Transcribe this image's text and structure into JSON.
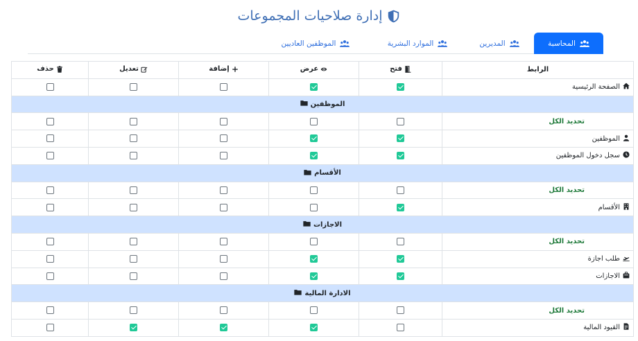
{
  "page": {
    "title": "إدارة صلاحيات المجموعات",
    "accent": "#0d6efd",
    "check_color": "#20c997",
    "group_row_color": "#cfe2ff"
  },
  "tabs": [
    {
      "label": "المحاسبة",
      "active": true,
      "icon": "users-icon"
    },
    {
      "label": "المديرين",
      "active": false,
      "icon": "users-icon"
    },
    {
      "label": "الموارد البشرية",
      "active": false,
      "icon": "users-icon"
    },
    {
      "label": "الموظفين العاديين",
      "active": false,
      "icon": "users-icon"
    }
  ],
  "columns": {
    "link": "الرابط",
    "open": "فتح",
    "view": "عرض",
    "add": "إضافة",
    "edit": "تعديل",
    "delete": "حذف"
  },
  "rows": [
    {
      "kind": "item",
      "label": "الصفحة الرئيسية",
      "icon": "home-icon",
      "perms": [
        true,
        true,
        false,
        false,
        false
      ]
    },
    {
      "kind": "group",
      "label": "الموظفين"
    },
    {
      "kind": "select",
      "label": "تحديد الكل",
      "perms": [
        false,
        false,
        false,
        false,
        false
      ]
    },
    {
      "kind": "item",
      "label": "الموظفين",
      "icon": "user-icon",
      "perms": [
        true,
        true,
        false,
        false,
        false
      ]
    },
    {
      "kind": "item",
      "label": "سجل دخول الموظفين",
      "icon": "clock-icon",
      "perms": [
        true,
        true,
        false,
        false,
        false
      ]
    },
    {
      "kind": "group",
      "label": "الأقسام"
    },
    {
      "kind": "select",
      "label": "تحديد الكل",
      "perms": [
        false,
        false,
        false,
        false,
        false
      ]
    },
    {
      "kind": "item",
      "label": "الأقسام",
      "icon": "building-icon",
      "perms": [
        true,
        false,
        false,
        false,
        false
      ]
    },
    {
      "kind": "group",
      "label": "الاجازات"
    },
    {
      "kind": "select",
      "label": "تحديد الكل",
      "perms": [
        false,
        false,
        false,
        false,
        false
      ]
    },
    {
      "kind": "item",
      "label": "طلب اجازة",
      "icon": "plane-icon",
      "perms": [
        true,
        true,
        false,
        false,
        false
      ]
    },
    {
      "kind": "item",
      "label": "الاجازات",
      "icon": "suitcase-icon",
      "perms": [
        true,
        true,
        false,
        false,
        false
      ]
    },
    {
      "kind": "group",
      "label": "الادارة المالية"
    },
    {
      "kind": "select",
      "label": "تحديد الكل",
      "perms": [
        false,
        false,
        false,
        false,
        false
      ]
    },
    {
      "kind": "item",
      "label": "القيود المالية",
      "icon": "file-invoice-icon",
      "perms": [
        false,
        true,
        true,
        true,
        false
      ]
    }
  ]
}
